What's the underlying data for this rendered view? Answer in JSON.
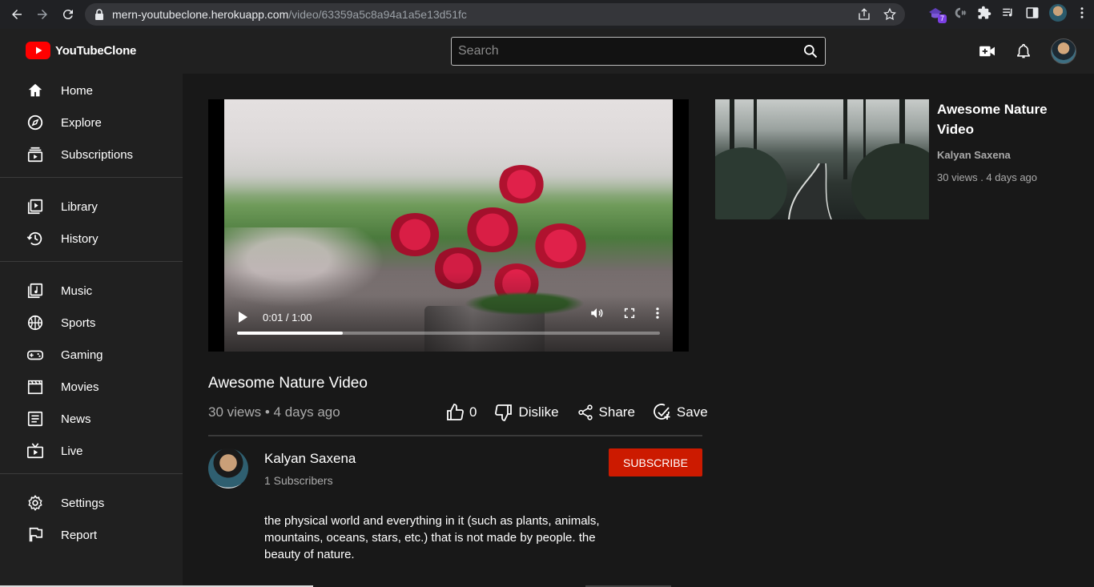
{
  "browser": {
    "url_host": "mern-youtubeclone.herokuapp.com",
    "url_path": "/video/63359a5c8a94a1a5e13d51fc",
    "extension_badge": "7"
  },
  "header": {
    "brand": "YouTubeClone",
    "search_placeholder": "Search"
  },
  "sidebar": {
    "groups": [
      [
        {
          "label": "Home",
          "icon": "home-icon"
        },
        {
          "label": "Explore",
          "icon": "compass-icon"
        },
        {
          "label": "Subscriptions",
          "icon": "subscriptions-icon"
        }
      ],
      [
        {
          "label": "Library",
          "icon": "library-icon"
        },
        {
          "label": "History",
          "icon": "history-icon"
        }
      ],
      [
        {
          "label": "Music",
          "icon": "music-icon"
        },
        {
          "label": "Sports",
          "icon": "sports-icon"
        },
        {
          "label": "Gaming",
          "icon": "gaming-icon"
        },
        {
          "label": "Movies",
          "icon": "movies-icon"
        },
        {
          "label": "News",
          "icon": "news-icon"
        },
        {
          "label": "Live",
          "icon": "live-icon"
        }
      ],
      [
        {
          "label": "Settings",
          "icon": "settings-icon"
        },
        {
          "label": "Report",
          "icon": "flag-icon"
        }
      ]
    ]
  },
  "player": {
    "time": "0:01 / 1:00",
    "progress": 0.25
  },
  "video": {
    "title": "Awesome Nature Video",
    "meta": "30 views • 4 days ago",
    "likes": "0",
    "dislike_label": "Dislike",
    "share_label": "Share",
    "save_label": "Save"
  },
  "channel": {
    "name": "Kalyan Saxena",
    "subscribers": "1 Subscribers",
    "subscribe_label": "SUBSCRIBE",
    "description": "the physical world and everything in it (such as plants, animals, mountains, oceans, stars, etc.) that is not made by people. the beauty of nature."
  },
  "recommendation": {
    "title": "Awesome Nature Video",
    "channel": "Kalyan Saxena",
    "meta": "30 views . 4 days ago"
  },
  "colors": {
    "accent": "#cc1a00",
    "logo_red": "#ff0000",
    "background": "#181818",
    "panel": "#202020"
  }
}
